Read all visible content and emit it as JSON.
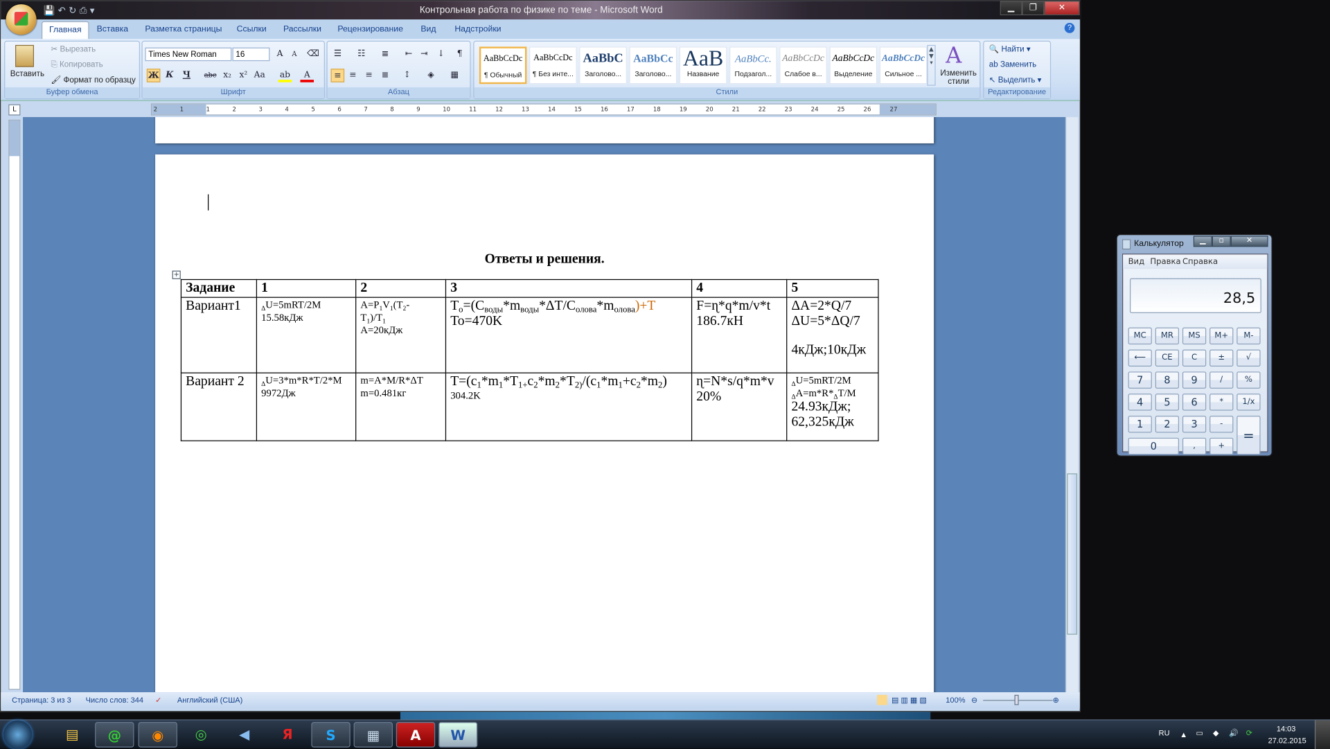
{
  "window": {
    "title": "Контрольная работа по физике по теме - Microsoft Word"
  },
  "tabs": [
    "Главная",
    "Вставка",
    "Разметка страницы",
    "Ссылки",
    "Рассылки",
    "Рецензирование",
    "Вид",
    "Надстройки"
  ],
  "ribbon": {
    "clipboard": {
      "label": "Буфер обмена",
      "paste": "Вставить",
      "cut": "Вырезать",
      "copy": "Копировать",
      "format_painter": "Формат по образцу"
    },
    "font": {
      "label": "Шрифт",
      "font_name": "Times New Roman",
      "font_size": "16",
      "bold": "Ж",
      "italic": "К",
      "underline": "Ч",
      "strike": "abe",
      "subscript": "x₂",
      "superscript": "x²",
      "case": "Aa",
      "grow": "A",
      "shrink": "A"
    },
    "paragraph": {
      "label": "Абзац"
    },
    "styles": {
      "label": "Стили",
      "items": [
        {
          "preview": "AaBbCcDc",
          "name": "¶ Обычный"
        },
        {
          "preview": "AaBbCcDc",
          "name": "¶ Без инте..."
        },
        {
          "preview": "AaBbC",
          "name": "Заголово..."
        },
        {
          "preview": "AaBbCc",
          "name": "Заголово..."
        },
        {
          "preview": "AaB",
          "name": "Название"
        },
        {
          "preview": "AaBbCc.",
          "name": "Подзагол..."
        },
        {
          "preview": "AaBbCcDc",
          "name": "Слабое в..."
        },
        {
          "preview": "AaBbCcDc",
          "name": "Выделение"
        },
        {
          "preview": "AaBbCcDc",
          "name": "Сильное ..."
        }
      ],
      "change_styles": "Изменить стили"
    },
    "editing": {
      "label": "Редактирование",
      "find": "Найти",
      "replace": "Заменить",
      "select": "Выделить"
    }
  },
  "document": {
    "heading": "Ответы  и решения.",
    "table": {
      "rows": [
        {
          "header": true,
          "cells": [
            {
              "lines": [
                {
                  "sm": false,
                  "runs": [
                    [
                      "Задание",
                      ""
                    ]
                  ]
                }
              ]
            },
            {
              "lines": [
                {
                  "sm": false,
                  "runs": [
                    [
                      "1",
                      ""
                    ]
                  ]
                }
              ]
            },
            {
              "lines": [
                {
                  "sm": false,
                  "runs": [
                    [
                      "2",
                      ""
                    ]
                  ]
                }
              ]
            },
            {
              "lines": [
                {
                  "sm": false,
                  "runs": [
                    [
                      "3",
                      ""
                    ]
                  ]
                }
              ]
            },
            {
              "lines": [
                {
                  "sm": false,
                  "runs": [
                    [
                      "4",
                      ""
                    ]
                  ]
                }
              ]
            },
            {
              "lines": [
                {
                  "sm": false,
                  "runs": [
                    [
                      "5",
                      ""
                    ]
                  ]
                }
              ]
            }
          ]
        },
        {
          "header": false,
          "cells": [
            {
              "lines": [
                {
                  "sm": false,
                  "runs": [
                    [
                      "Вариант1",
                      ""
                    ]
                  ]
                }
              ]
            },
            {
              "lines": [
                {
                  "sm": true,
                  "runs": [
                    [
                      "Δ",
                      "sub"
                    ],
                    [
                      "U=5mRT/2M",
                      ""
                    ]
                  ]
                },
                {
                  "sm": true,
                  "runs": [
                    [
                      "15.58кДж",
                      ""
                    ]
                  ]
                }
              ]
            },
            {
              "lines": [
                {
                  "sm": true,
                  "runs": [
                    [
                      "A=P",
                      ""
                    ],
                    [
                      "1",
                      "sub"
                    ],
                    [
                      "V",
                      ""
                    ],
                    [
                      "1",
                      "sub"
                    ],
                    [
                      "(T",
                      ""
                    ],
                    [
                      "2",
                      "sub"
                    ],
                    [
                      "-",
                      ""
                    ]
                  ]
                },
                {
                  "sm": true,
                  "runs": [
                    [
                      "T",
                      ""
                    ],
                    [
                      "1",
                      "sub"
                    ],
                    [
                      ")/T",
                      ""
                    ],
                    [
                      "1",
                      "sub"
                    ]
                  ]
                },
                {
                  "sm": true,
                  "runs": [
                    [
                      "A=20кДж",
                      ""
                    ]
                  ]
                }
              ]
            },
            {
              "lines": [
                {
                  "sm": false,
                  "runs": [
                    [
                      "T",
                      ""
                    ],
                    [
                      "o",
                      "sub"
                    ],
                    [
                      "=(C",
                      ""
                    ],
                    [
                      "воды",
                      "sub"
                    ],
                    [
                      "*m",
                      ""
                    ],
                    [
                      "воды",
                      "sub"
                    ],
                    [
                      "*ΔT/C",
                      ""
                    ],
                    [
                      "олова",
                      "sub"
                    ],
                    [
                      "*m",
                      ""
                    ],
                    [
                      "олова",
                      "sub"
                    ],
                    [
                      ")+T",
                      ""
                    ]
                  ]
                },
                {
                  "sm": false,
                  "runs": [
                    [
                      "To=470K",
                      ""
                    ]
                  ]
                }
              ]
            },
            {
              "lines": [
                {
                  "sm": false,
                  "runs": [
                    [
                      "F=ɳ*q*m/v*t",
                      ""
                    ]
                  ]
                },
                {
                  "sm": false,
                  "runs": [
                    [
                      "186.7кН",
                      ""
                    ]
                  ]
                }
              ]
            },
            {
              "lines": [
                {
                  "sm": false,
                  "runs": [
                    [
                      "ΔA=2*Q/7",
                      ""
                    ]
                  ]
                },
                {
                  "sm": false,
                  "runs": [
                    [
                      "ΔU=5*ΔQ/7",
                      ""
                    ]
                  ]
                },
                {
                  "sm": false,
                  "runs": []
                },
                {
                  "sm": false,
                  "runs": [
                    [
                      "4кДж;10кДж",
                      ""
                    ]
                  ]
                }
              ]
            }
          ]
        },
        {
          "header": false,
          "cells": [
            {
              "lines": [
                {
                  "sm": false,
                  "runs": [
                    [
                      "Вариант 2",
                      ""
                    ]
                  ]
                }
              ]
            },
            {
              "lines": [
                {
                  "sm": true,
                  "runs": [
                    [
                      "Δ",
                      "sub"
                    ],
                    [
                      "U=3*m*R*T/2*M",
                      ""
                    ]
                  ]
                },
                {
                  "sm": true,
                  "runs": [
                    [
                      "9972Дж",
                      ""
                    ]
                  ]
                }
              ]
            },
            {
              "lines": [
                {
                  "sm": true,
                  "runs": [
                    [
                      "m=A*M/R*ΔT",
                      ""
                    ]
                  ]
                },
                {
                  "sm": true,
                  "runs": [
                    [
                      "m=0.481кг",
                      ""
                    ]
                  ]
                }
              ]
            },
            {
              "lines": [
                {
                  "sm": false,
                  "runs": [
                    [
                      "T=(c",
                      ""
                    ],
                    [
                      "1",
                      "sub"
                    ],
                    [
                      "*m",
                      ""
                    ],
                    [
                      "1",
                      "sub"
                    ],
                    [
                      "*T",
                      ""
                    ],
                    [
                      "1+",
                      "sub"
                    ],
                    [
                      "c",
                      ""
                    ],
                    [
                      "2",
                      "sub"
                    ],
                    [
                      "*m",
                      ""
                    ],
                    [
                      "2",
                      "sub"
                    ],
                    [
                      "*T",
                      ""
                    ],
                    [
                      "2)",
                      "sub"
                    ],
                    [
                      "/(c",
                      ""
                    ],
                    [
                      "1",
                      "sub"
                    ],
                    [
                      "*m",
                      ""
                    ],
                    [
                      "1",
                      "sub"
                    ],
                    [
                      "+c",
                      ""
                    ],
                    [
                      "2",
                      "sub"
                    ],
                    [
                      "*m",
                      ""
                    ],
                    [
                      "2",
                      "sub"
                    ],
                    [
                      ")",
                      ""
                    ]
                  ]
                },
                {
                  "sm": true,
                  "runs": [
                    [
                      "304.2K",
                      ""
                    ]
                  ]
                }
              ]
            },
            {
              "lines": [
                {
                  "sm": false,
                  "runs": [
                    [
                      "ɳ=N*s/q*m*v",
                      ""
                    ]
                  ]
                },
                {
                  "sm": false,
                  "runs": [
                    [
                      "20%",
                      ""
                    ]
                  ]
                }
              ]
            },
            {
              "lines": [
                {
                  "sm": true,
                  "runs": [
                    [
                      "Δ",
                      "sub"
                    ],
                    [
                      "U=5mRT/2M",
                      ""
                    ]
                  ]
                },
                {
                  "sm": true,
                  "runs": [
                    [
                      "Δ",
                      "sub"
                    ],
                    [
                      "A=m*R*",
                      ""
                    ],
                    [
                      "Δ",
                      "sub"
                    ],
                    [
                      "T/M",
                      ""
                    ]
                  ]
                },
                {
                  "sm": false,
                  "runs": [
                    [
                      "24.93кДж;",
                      ""
                    ]
                  ]
                },
                {
                  "sm": false,
                  "runs": [
                    [
                      "62,325кДж",
                      ""
                    ]
                  ]
                }
              ]
            }
          ]
        }
      ]
    }
  },
  "ruler": {
    "marks": [
      "2",
      "1",
      "1",
      "2",
      "3",
      "4",
      "5",
      "6",
      "7",
      "8",
      "9",
      "10",
      "11",
      "12",
      "13",
      "14",
      "15",
      "16",
      "17",
      "18",
      "19",
      "20",
      "21",
      "22",
      "23",
      "24",
      "25",
      "26",
      "27"
    ]
  },
  "statusbar": {
    "page": "Страница: 3 из 3",
    "words": "Число слов: 344",
    "language": "Английский (США)",
    "zoom": "100%"
  },
  "calculator": {
    "title": "Калькулятор",
    "menu": [
      "Вид",
      "Правка",
      "Справка"
    ],
    "display": "28,5",
    "buttons": [
      "MC",
      "MR",
      "MS",
      "M+",
      "M-",
      "⟵",
      "CE",
      "C",
      "±",
      "√",
      "7",
      "8",
      "9",
      "/",
      "%",
      "4",
      "5",
      "6",
      "*",
      "1/x",
      "1",
      "2",
      "3",
      "-",
      "=",
      "0",
      ",",
      "+"
    ]
  },
  "taskbar": {
    "language": "RU",
    "time": "14:03",
    "date": "27.02.2015"
  },
  "colors": {
    "ribbon_text": "#15428b",
    "doc_background": "#5b84b8",
    "accent": "#f0b64a"
  }
}
